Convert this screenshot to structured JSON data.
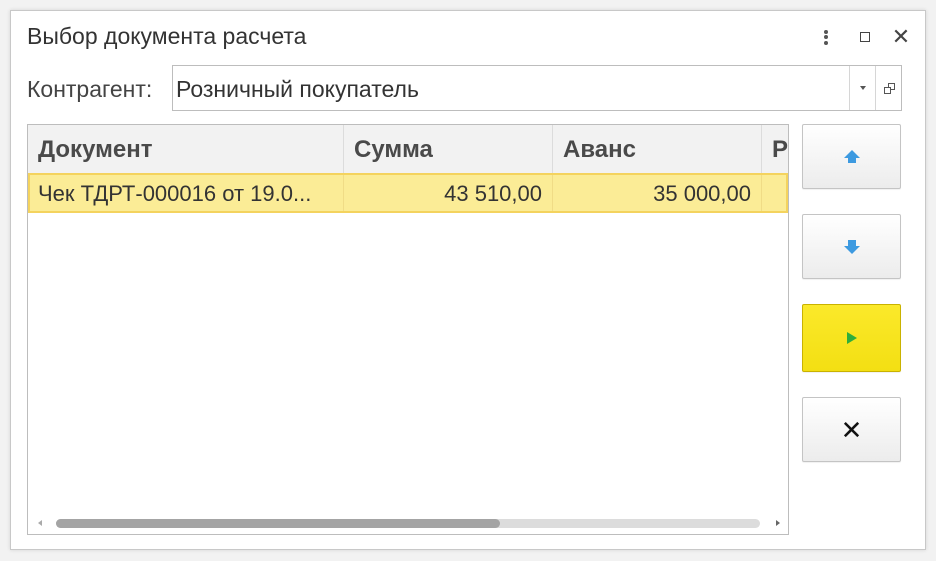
{
  "window": {
    "title": "Выбор документа расчета",
    "controls": {
      "more_icon": "kebab-vertical-icon",
      "maximize_icon": "maximize-icon",
      "close_icon": "close-icon",
      "close_glyph": "✕"
    }
  },
  "counterparty": {
    "label": "Контрагент:",
    "value": "Розничный покупатель",
    "dropdown_icon": "caret-down-icon",
    "open_icon": "open-form-icon"
  },
  "table": {
    "columns": [
      "Документ",
      "Сумма",
      "Аванс",
      "Р"
    ],
    "rows": [
      {
        "document": "Чек ТДРТ-000016 от 19.0...",
        "sum": "43 510,00",
        "advance": "35 000,00",
        "r": ""
      }
    ],
    "selected_row_color": "#fbec96",
    "horizontal_scroll_fraction": 0.63
  },
  "side_buttons": {
    "move_up_icon": "arrow-up-icon",
    "move_down_icon": "arrow-down-icon",
    "select_icon": "play-icon",
    "cancel_icon": "close-icon",
    "cancel_glyph": "✕",
    "accent_color": "#f3df13"
  }
}
